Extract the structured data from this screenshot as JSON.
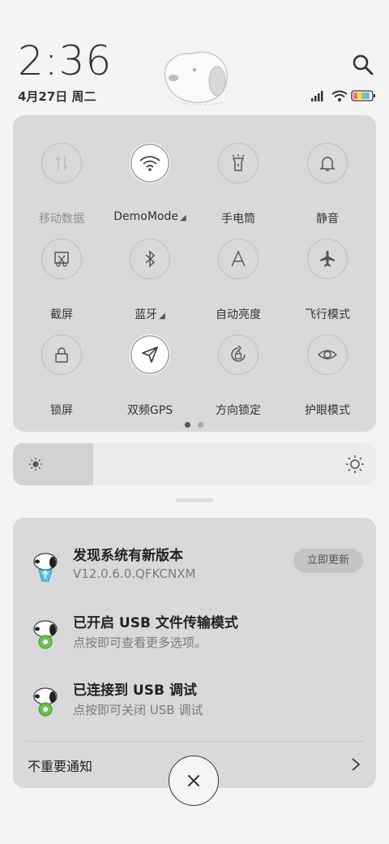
{
  "status_bar": {
    "time": "2:36",
    "date": "4月27日 周二"
  },
  "quick_settings": {
    "tiles": [
      {
        "label": "移动数据",
        "icon": "mobile-data-icon",
        "active": false,
        "dim": true
      },
      {
        "label": "DemoMode",
        "icon": "wifi-icon",
        "active": true,
        "dim": false,
        "expandable": true
      },
      {
        "label": "手电筒",
        "icon": "flashlight-icon",
        "active": false,
        "dim": false
      },
      {
        "label": "静音",
        "icon": "bell-icon",
        "active": false,
        "dim": false
      },
      {
        "label": "截屏",
        "icon": "screenshot-icon",
        "active": false,
        "dim": false
      },
      {
        "label": "蓝牙",
        "icon": "bluetooth-icon",
        "active": false,
        "dim": false,
        "expandable": true
      },
      {
        "label": "自动亮度",
        "icon": "auto-brightness-icon",
        "active": false,
        "dim": false
      },
      {
        "label": "飞行模式",
        "icon": "airplane-icon",
        "active": false,
        "dim": false
      },
      {
        "label": "锁屏",
        "icon": "lock-icon",
        "active": false,
        "dim": false
      },
      {
        "label": "双频GPS",
        "icon": "gps-icon",
        "active": true,
        "dim": false
      },
      {
        "label": "方向锁定",
        "icon": "rotation-lock-icon",
        "active": false,
        "dim": false
      },
      {
        "label": "护眼模式",
        "icon": "eye-icon",
        "active": false,
        "dim": false
      }
    ],
    "page_count": 2,
    "current_page": 1
  },
  "brightness": {
    "level": 0.22
  },
  "notifications": [
    {
      "title": "发现系统有新版本",
      "subtitle": "V12.0.6.0.QFKCNXM",
      "action_label": "立即更新"
    },
    {
      "title": "已开启 USB 文件传输模式",
      "subtitle": "点按即可查看更多选项。"
    },
    {
      "title": "已连接到 USB 调试",
      "subtitle": "点按即可关闭 USB 调试"
    }
  ],
  "footer": {
    "unimportant_label": "不重要通知"
  },
  "colors": {
    "panel": "#d9d9db",
    "accent": "#333333"
  }
}
